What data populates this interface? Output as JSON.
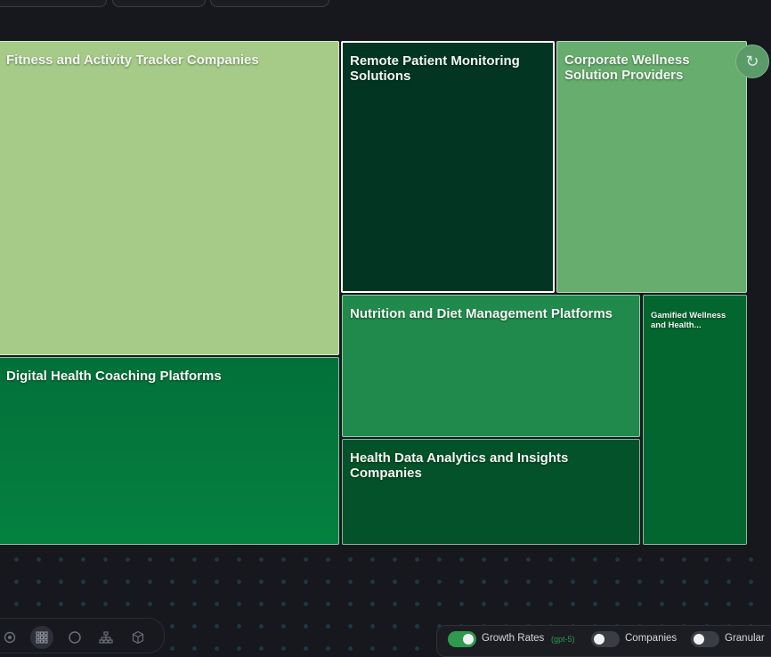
{
  "treemap": {
    "tiles": [
      {
        "label": "Fitness and Activity Tracker Companies",
        "color": "#a6ca88"
      },
      {
        "label": "Remote Patient Monitoring Solutions",
        "color": "#023623",
        "selected": true
      },
      {
        "label": "Corporate Wellness Solution Providers",
        "color": "#67ad6e"
      },
      {
        "label": "Digital Health Coaching Platforms",
        "color": "#04773a"
      },
      {
        "label": "Nutrition and Diet Management Platforms",
        "color": "#208a4d"
      },
      {
        "label": "Gamified Wellness and Health...",
        "color": "#03662f"
      },
      {
        "label": "Health Data Analytics and Insights Companies",
        "color": "#045229"
      }
    ]
  },
  "toggles": {
    "growth_rates": {
      "label": "Growth Rates",
      "model": "(gpt-5)",
      "on": true
    },
    "companies": {
      "label": "Companies",
      "on": false
    },
    "granular": {
      "label": "Granular",
      "on": false
    }
  },
  "toolbar": {
    "icons": [
      "radio-dot-icon",
      "grid-icon",
      "circle-icon",
      "hierarchy-icon",
      "cube-icon"
    ],
    "active": "grid-icon"
  },
  "colors": {
    "background": "#16181d",
    "accent_green": "#2f9a4e"
  }
}
